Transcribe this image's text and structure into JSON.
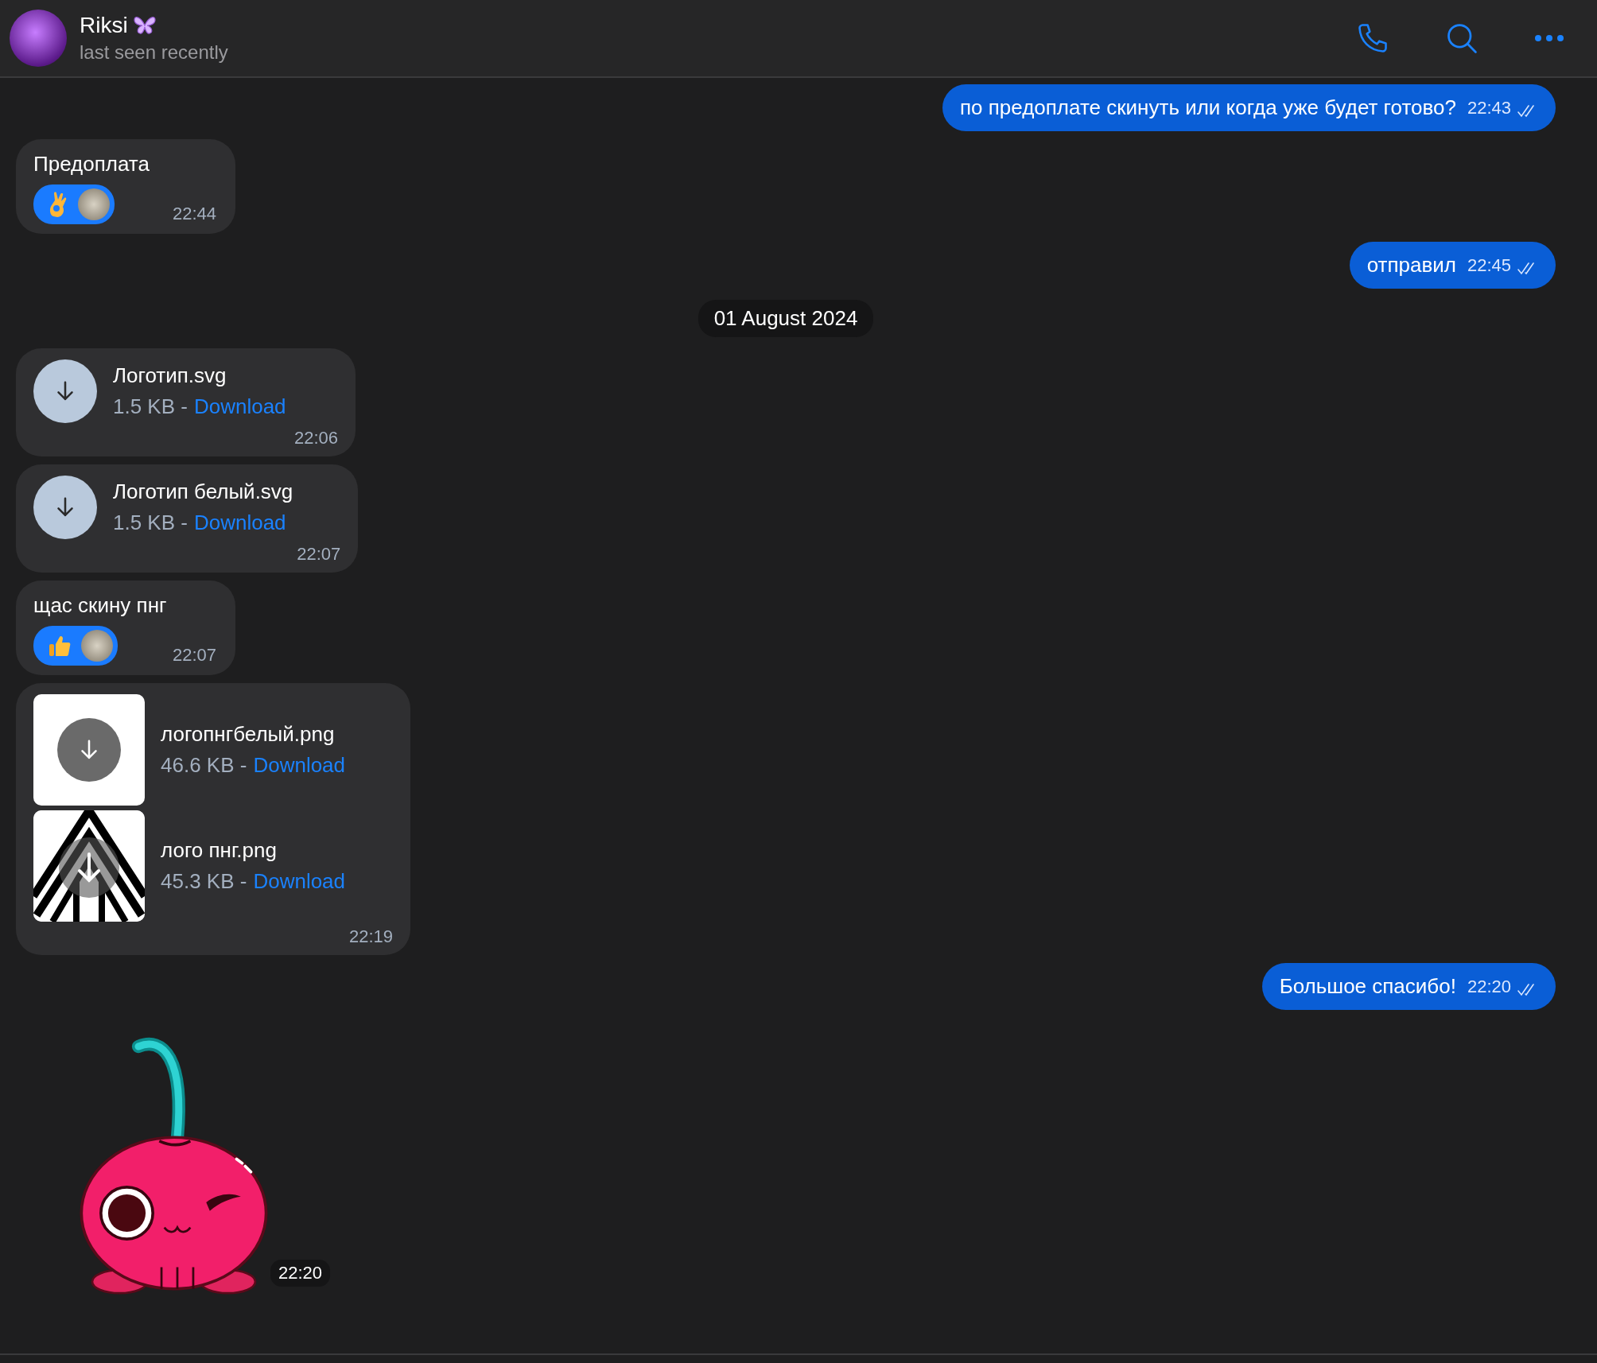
{
  "header": {
    "name": "Riksi",
    "status": "last seen recently"
  },
  "messages": [
    {
      "kind": "text",
      "outgoing": true,
      "text": "по предоплате скинуть или когда уже будет готово?",
      "time": "22:43",
      "read": true
    },
    {
      "kind": "text",
      "outgoing": false,
      "text": "Предоплата",
      "reaction": {
        "kind": "ok"
      },
      "time": "22:44"
    },
    {
      "kind": "text",
      "outgoing": true,
      "text": "отправил",
      "time": "22:45",
      "read": true
    },
    {
      "kind": "date",
      "text": "01 August 2024"
    },
    {
      "kind": "file",
      "outgoing": false,
      "files": [
        {
          "kind": "plain",
          "name": "Логотип.svg",
          "size": "1.5 KB -",
          "action": "Download"
        }
      ],
      "time": "22:06"
    },
    {
      "kind": "file",
      "outgoing": false,
      "files": [
        {
          "kind": "plain",
          "name": "Логотип белый.svg",
          "size": "1.5 KB -",
          "action": "Download"
        }
      ],
      "time": "22:07"
    },
    {
      "kind": "text",
      "outgoing": false,
      "text": "щас скину пнг",
      "reaction": {
        "kind": "thumbs_up"
      },
      "time": "22:07"
    },
    {
      "kind": "file",
      "outgoing": false,
      "files": [
        {
          "kind": "blank_preview",
          "name": "логопнгбелый.png",
          "size": "46.6 KB -",
          "action": "Download"
        },
        {
          "kind": "logo_preview",
          "name": "лого пнг.png",
          "size": "45.3 KB -",
          "action": "Download"
        }
      ],
      "time": "22:19"
    },
    {
      "kind": "text",
      "outgoing": true,
      "text": "Большое спасибо!",
      "time": "22:20",
      "read": true
    },
    {
      "kind": "sticker",
      "time": "22:20"
    }
  ]
}
